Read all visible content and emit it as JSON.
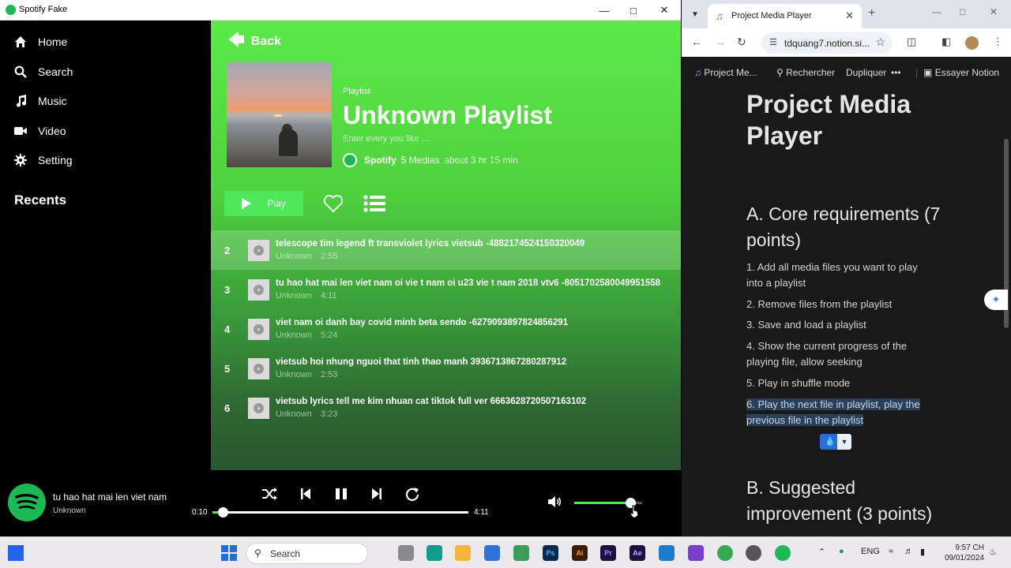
{
  "spotify": {
    "window_title": "Spotify Fake",
    "nav": [
      {
        "label": "Home",
        "icon": "home-icon"
      },
      {
        "label": "Search",
        "icon": "search-icon"
      },
      {
        "label": "Music",
        "icon": "music-icon"
      },
      {
        "label": "Video",
        "icon": "video-icon"
      },
      {
        "label": "Setting",
        "icon": "gear-icon"
      }
    ],
    "recents_label": "Recents",
    "back_label": "Back",
    "playlist": {
      "label": "Playlist",
      "title": "Unknown Playlist",
      "description": "Enter every you like ....",
      "owner": "Spotify",
      "count": "5 Medias",
      "duration": "about 3 hr 15 min",
      "play_label": "Play"
    },
    "tracks": [
      {
        "num": "2",
        "title": "telescope tim legend ft transviolet lyrics vietsub -4882174524150320049",
        "artist": "Unknown",
        "duration": "2:55",
        "active": true
      },
      {
        "num": "3",
        "title": "tu hao hat mai len viet nam oi vie t nam oi u23 vie t nam 2018 vtv6 -8051702580049951558",
        "artist": "Unknown",
        "duration": "4:11",
        "active": false
      },
      {
        "num": "4",
        "title": "viet nam oi danh bay covid minh beta sendo -6279093897824856291",
        "artist": "Unknown",
        "duration": "5:24",
        "active": false
      },
      {
        "num": "5",
        "title": "vietsub hoi nhung nguoi that tinh thao manh 3936713867280287912",
        "artist": "Unknown",
        "duration": "2:53",
        "active": false
      },
      {
        "num": "6",
        "title": "vietsub lyrics tell me kim nhuan cat tiktok full ver 6663628720507163102",
        "artist": "Unknown",
        "duration": "3:23",
        "active": false
      }
    ],
    "now_playing": {
      "title": "tu hao hat mai len viet nam",
      "artist": "Unknown",
      "elapsed": "0:10",
      "total": "4:11",
      "progress": 0.04,
      "volume": 0.82
    },
    "accent": "#1db954"
  },
  "chrome": {
    "tab_title": "Project Media Player",
    "url": "tdquang7.notion.si...",
    "notion_bar": {
      "page": "Project Me...",
      "search": "Rechercher",
      "duplicate": "Dupliquer",
      "more": "•••",
      "try": "Essayer Notion"
    },
    "page_title": "Project Media Player",
    "section_a": "A. Core requirements (7 points)",
    "items": [
      "1. Add all media files you want to play into a playlist",
      "2. Remove files from the playlist",
      "3. Save and load a playlist",
      "4. Show the current progress of the playing file, allow seeking",
      "5. Play in shuffle mode",
      "6. Play the next file in playlist, play the previous file in the playlist"
    ],
    "section_b": "B. Suggested improvement (3 points)"
  },
  "taskbar": {
    "search_label": "Search",
    "lang": "ENG",
    "time": "9:57 CH",
    "date": "09/01/2024"
  }
}
